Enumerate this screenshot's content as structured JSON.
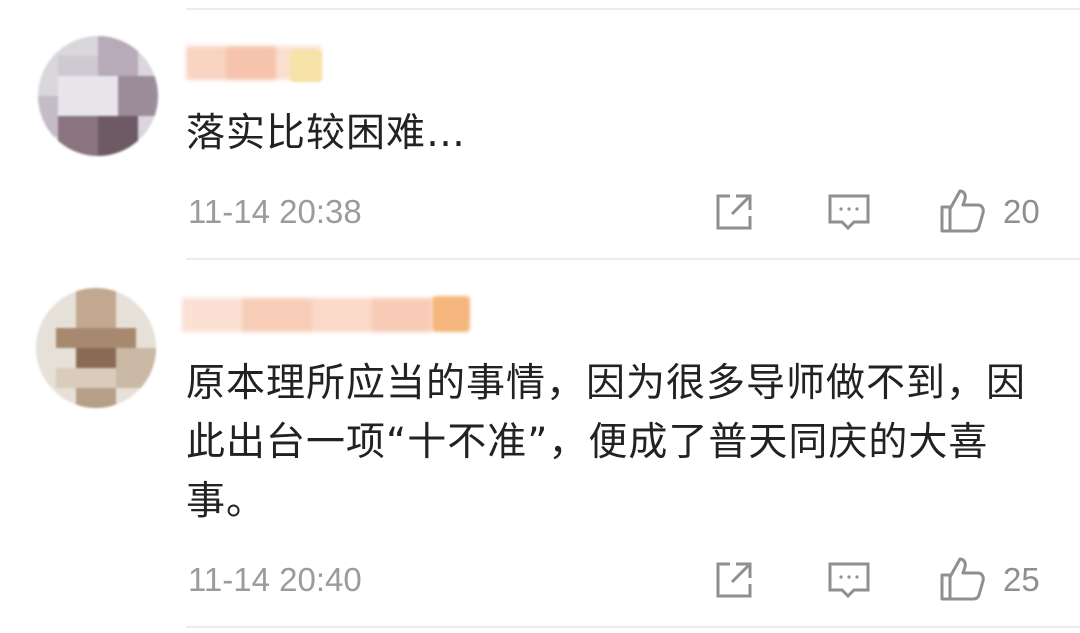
{
  "comments": [
    {
      "text": "落实比较困难…",
      "time": "11-14 20:38",
      "likes": "20",
      "icons": [
        "share-icon",
        "reply-icon",
        "thumbs-up-icon"
      ]
    },
    {
      "text": "原本理所应当的事情，因为很多导师做不到，因此出台一项“十不准”，便成了普天同庆的大喜事。",
      "time": "11-14 20:40",
      "likes": "25",
      "icons": [
        "share-icon",
        "reply-icon",
        "thumbs-up-icon"
      ]
    }
  ],
  "colors": {
    "text": "#222222",
    "meta": "#9b9b9b",
    "divider": "#ececec"
  }
}
